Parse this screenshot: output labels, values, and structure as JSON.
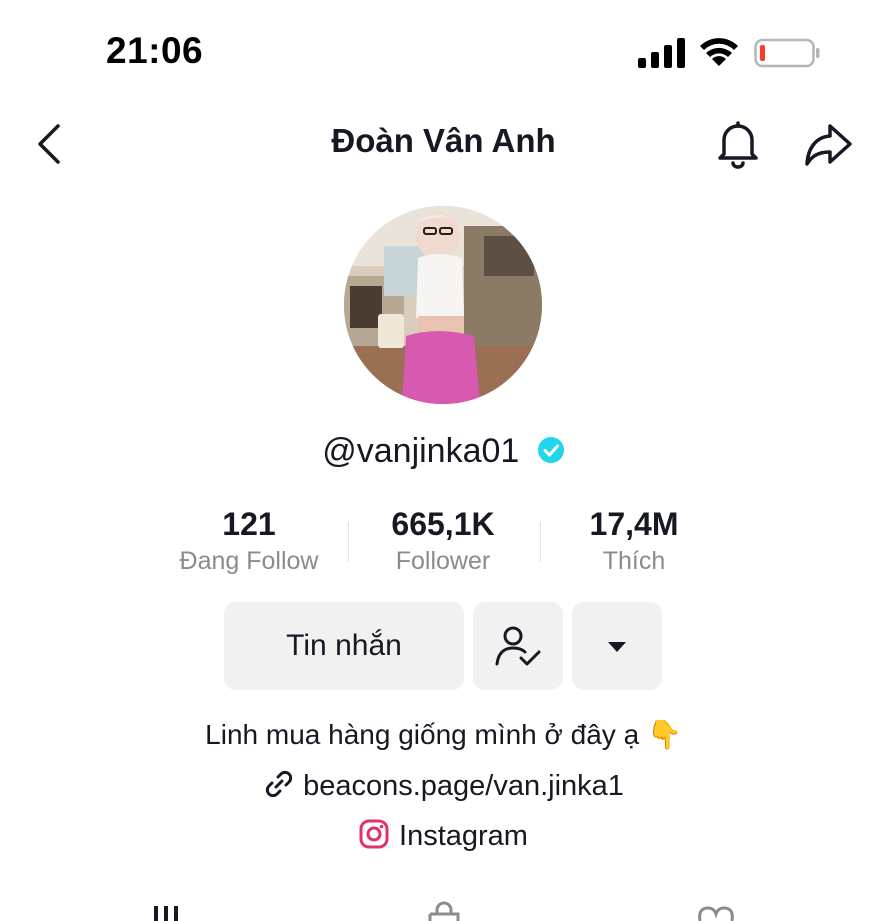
{
  "status_bar": {
    "time": "21:06"
  },
  "header": {
    "title": "Đoàn Vân Anh"
  },
  "profile": {
    "username": "@vanjinka01",
    "stats": [
      {
        "value": "121",
        "label": "Đang Follow"
      },
      {
        "value": "665,1K",
        "label": "Follower"
      },
      {
        "value": "17,4M",
        "label": "Thích"
      }
    ],
    "message_button": "Tin nhắn",
    "bio": "Linh mua hàng giống mình ở đây ạ 👇",
    "link": "beacons.page/van.jinka1",
    "instagram": "Instagram"
  },
  "colors": {
    "verified": "#20d5ec",
    "instagram": "#e1306c",
    "battery_low": "#ff3b30"
  },
  "icons": [
    "back-icon",
    "bell-icon",
    "share-icon",
    "verified-icon",
    "friends-icon",
    "dropdown-icon",
    "link-icon",
    "instagram-icon",
    "videos-tab-icon",
    "shop-tab-icon",
    "liked-tab-icon"
  ]
}
